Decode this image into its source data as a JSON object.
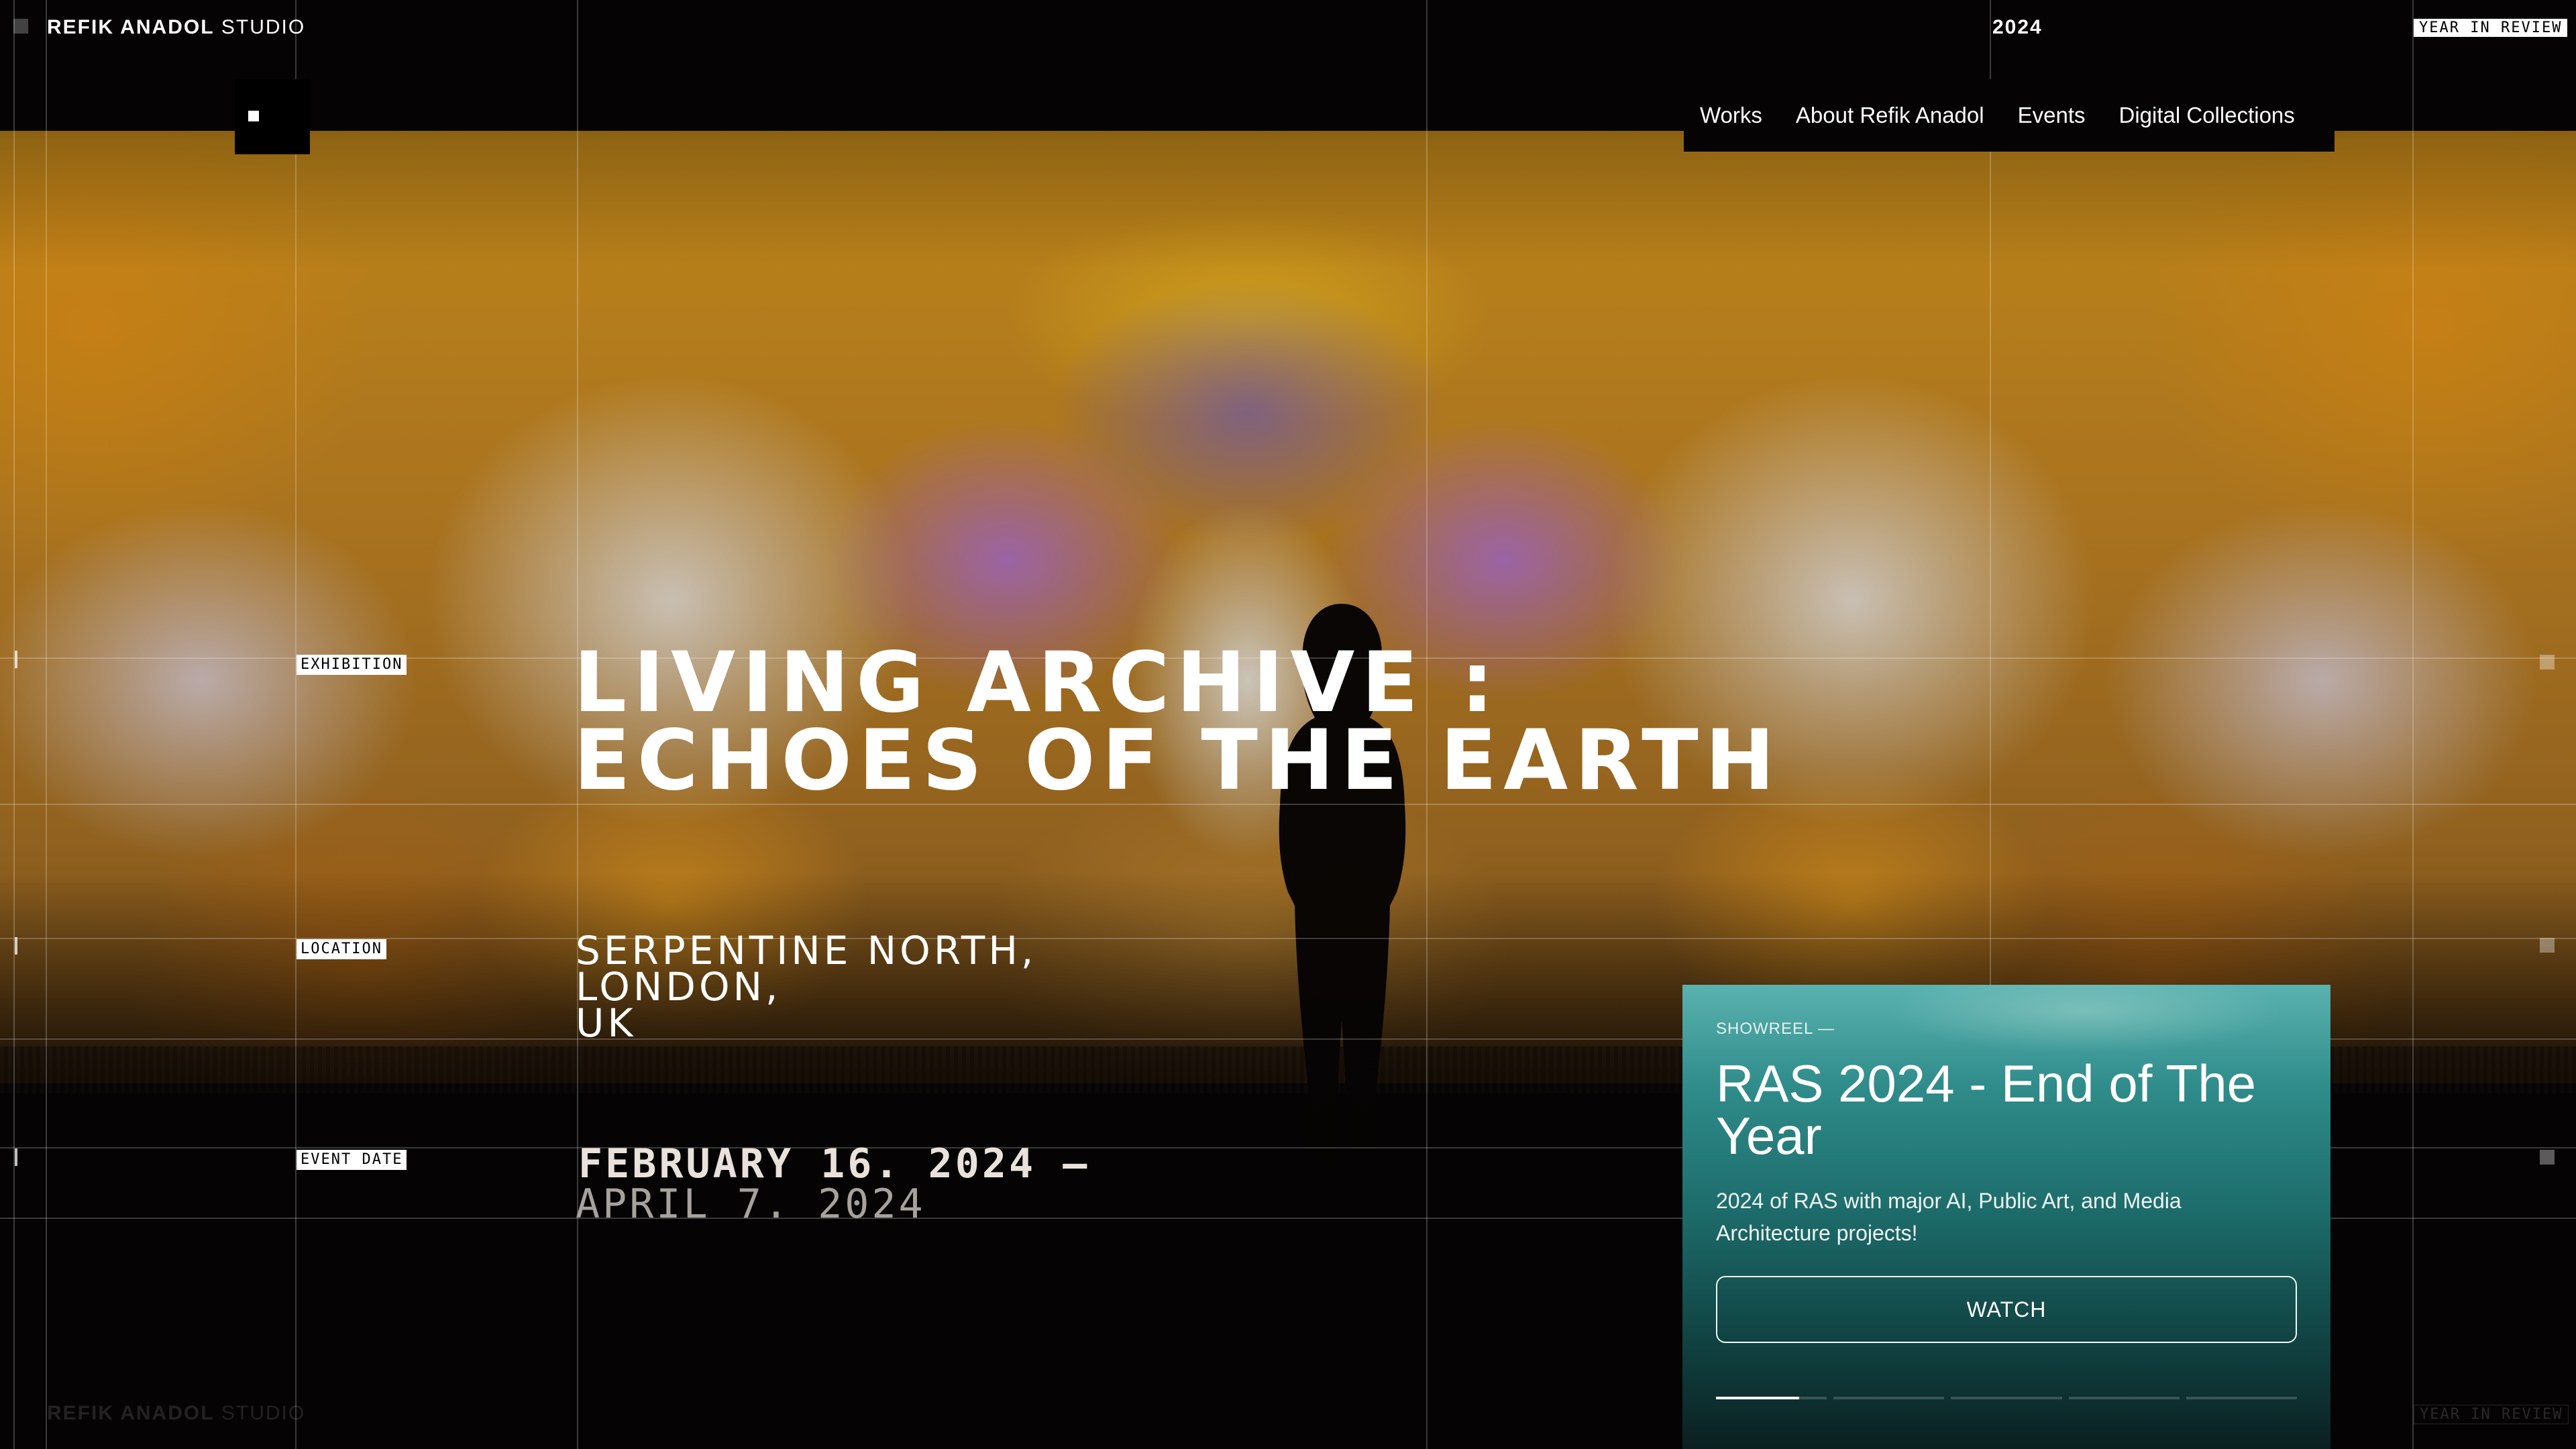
{
  "brand": {
    "name_bold": "REFIK ANADOL",
    "name_light": "STUDIO"
  },
  "header": {
    "year": "2024",
    "year_in_review_tag": "YEAR IN REVIEW"
  },
  "nav": {
    "items": [
      "Works",
      "About Refik Anadol",
      "Events",
      "Digital Collections"
    ]
  },
  "exhibition": {
    "exhibition_tag": "EXHIBITION",
    "title_line1": "LIVING ARCHIVE :",
    "title_line2": "ECHOES OF THE EARTH",
    "location_tag": "LOCATION",
    "location_line1": "SERPENTINE NORTH,",
    "location_line2": "LONDON,",
    "location_line3": "UK",
    "date_tag": "EVENT DATE",
    "date_start": "FEBRUARY 16. 2024 —",
    "date_end": "APRIL 7. 2024"
  },
  "showreel": {
    "kicker": "SHOWREEL —",
    "title": "RAS 2024 - End of The Year",
    "description": "2024 of RAS with major AI, Public Art, and Media Architecture projects!",
    "watch_label": "WATCH",
    "slides_total": 5,
    "active_slide": 1,
    "active_slide_progress": 0.75
  },
  "colors": {
    "card_teal": "#1d6d6c",
    "background": "#050303",
    "accent_gold": "#d99a22"
  },
  "icons": {
    "menu": "menu-square-icon"
  }
}
